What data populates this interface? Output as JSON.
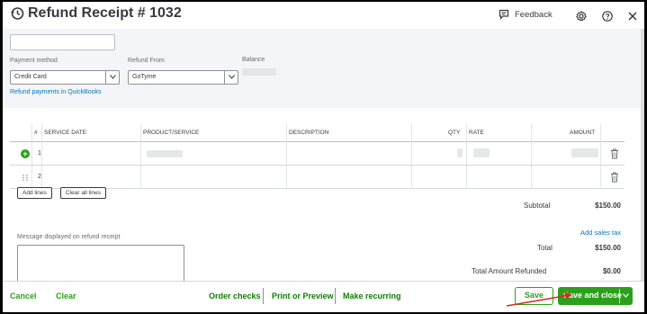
{
  "header": {
    "title": "Refund Receipt # 1032",
    "feedback_label": "Feedback"
  },
  "form": {
    "payment_method": {
      "label": "Payment method",
      "value": "Credit Card"
    },
    "refund_from": {
      "label": "Refund From",
      "value": "GoTyme"
    },
    "balance": {
      "label": "Balance"
    },
    "refund_link": "Refund payments in QuickBooks"
  },
  "table": {
    "columns": [
      "#",
      "SERVICE DATE",
      "PRODUCT/SERVICE",
      "DESCRIPTION",
      "QTY",
      "RATE",
      "AMOUNT"
    ],
    "rows": [
      {
        "num": "1"
      },
      {
        "num": "2"
      }
    ],
    "add_lines": "Add lines",
    "clear_lines": "Clear all lines"
  },
  "summary": {
    "subtotal_label": "Subtotal",
    "subtotal_value": "$150.00",
    "add_sales_tax": "Add sales tax",
    "total_label": "Total",
    "total_value": "$150.00",
    "refunded_label": "Total Amount Refunded",
    "refunded_value": "$0.00"
  },
  "message": {
    "label": "Message displayed on refund receipt"
  },
  "footer": {
    "cancel": "Cancel",
    "clear": "Clear",
    "order_checks": "Order checks",
    "print_preview": "Print or Preview",
    "make_recurring": "Make recurring",
    "save": "Save",
    "save_and_close": "Save and close"
  },
  "colors": {
    "accent_green": "#2ca01c",
    "link_blue": "#0077c5",
    "annotation_red": "#d52b1e"
  }
}
